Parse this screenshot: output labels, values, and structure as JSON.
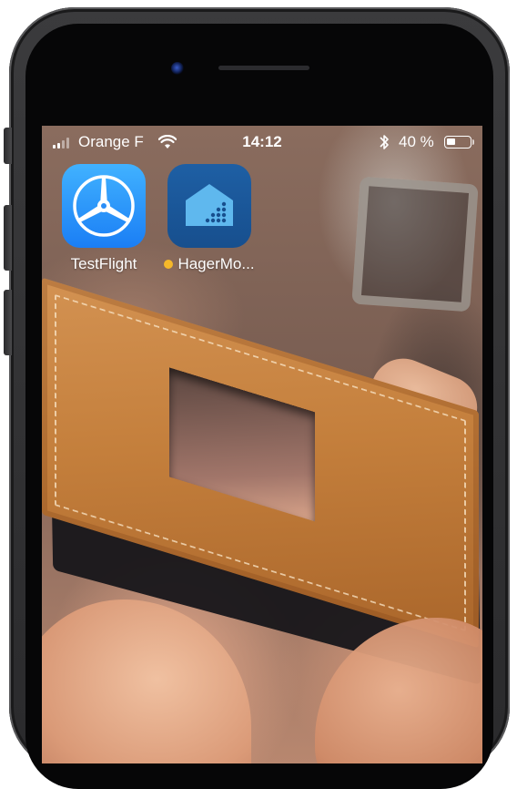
{
  "status_bar": {
    "carrier": "Orange F",
    "time": "14:12",
    "battery_percent": "40 %",
    "battery_level": 0.4,
    "signal_bars": 2,
    "signal_total": 4
  },
  "apps": [
    {
      "label": "TestFlight",
      "icon": "testflight-icon",
      "new_badge": false
    },
    {
      "label": "HagerMo...",
      "icon": "hager-icon",
      "new_badge": true
    }
  ],
  "colors": {
    "testflight_blue": "#1a7ef5",
    "hager_blue": "#174f8e",
    "new_dot": "#f5b82a"
  }
}
